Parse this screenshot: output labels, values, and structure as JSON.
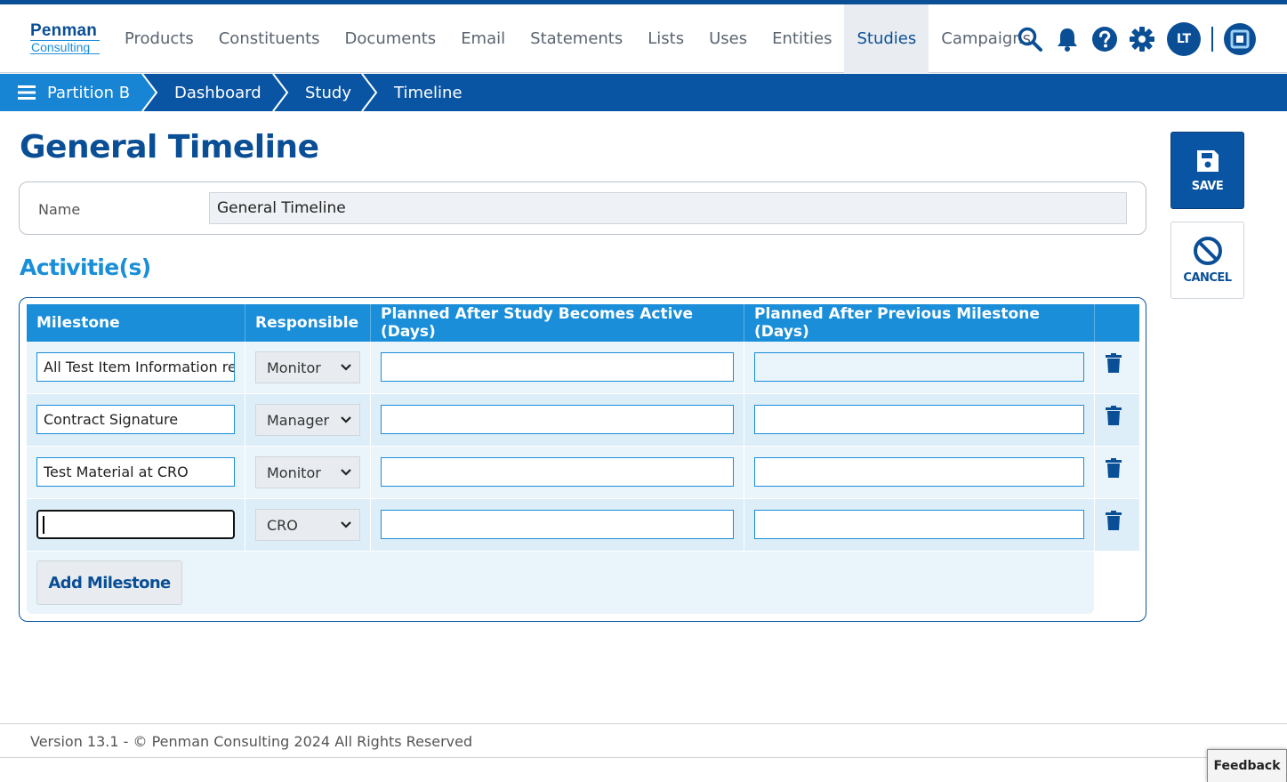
{
  "logo": {
    "line1": "Penman",
    "line2": "Consulting"
  },
  "nav": [
    {
      "label": "Products",
      "active": false
    },
    {
      "label": "Constituents",
      "active": false
    },
    {
      "label": "Documents",
      "active": false
    },
    {
      "label": "Email",
      "active": false
    },
    {
      "label": "Statements",
      "active": false
    },
    {
      "label": "Lists",
      "active": false
    },
    {
      "label": "Uses",
      "active": false
    },
    {
      "label": "Entities",
      "active": false
    },
    {
      "label": "Studies",
      "active": true
    },
    {
      "label": "Campaigns",
      "active": false
    }
  ],
  "user": {
    "initials": "LT"
  },
  "icons": {
    "search": "search-icon",
    "bell": "bell-icon",
    "help": "help-icon",
    "settings": "gear-icon",
    "app": "app-switcher-icon",
    "menu": "hamburger-icon",
    "trash": "trash-icon",
    "save": "floppy-disk-icon",
    "cancel": "ban-icon"
  },
  "breadcrumb": {
    "partition": "Partition B",
    "items": [
      "Dashboard",
      "Study",
      "Timeline"
    ]
  },
  "page": {
    "title": "General Timeline"
  },
  "form": {
    "name_label": "Name",
    "name_value": "General Timeline"
  },
  "activities": {
    "title": "Activitie(s)",
    "columns": [
      "Milestone",
      "Responsible",
      "Planned After Study Becomes Active (Days)",
      "Planned After Previous Milestone (Days)"
    ],
    "rows": [
      {
        "milestone": "All Test Item Information re",
        "responsible": "Monitor",
        "after_active": "",
        "after_previous": ""
      },
      {
        "milestone": "Contract Signature",
        "responsible": "Manager",
        "after_active": "",
        "after_previous": ""
      },
      {
        "milestone": "Test Material at CRO",
        "responsible": "Monitor",
        "after_active": "",
        "after_previous": ""
      },
      {
        "milestone": "",
        "responsible": "CRO",
        "after_active": "",
        "after_previous": ""
      }
    ],
    "add_label": "Add Milestone"
  },
  "actions": {
    "save_label": "SAVE",
    "cancel_label": "CANCEL"
  },
  "footer": {
    "text": "Version 13.1 - © Penman Consulting 2024 All Rights Reserved"
  },
  "feedback": {
    "label": "Feedback"
  },
  "colors": {
    "brand": "#0a4f96",
    "accent": "#1a8ed8",
    "breadcrumb": "#0a55a3"
  }
}
